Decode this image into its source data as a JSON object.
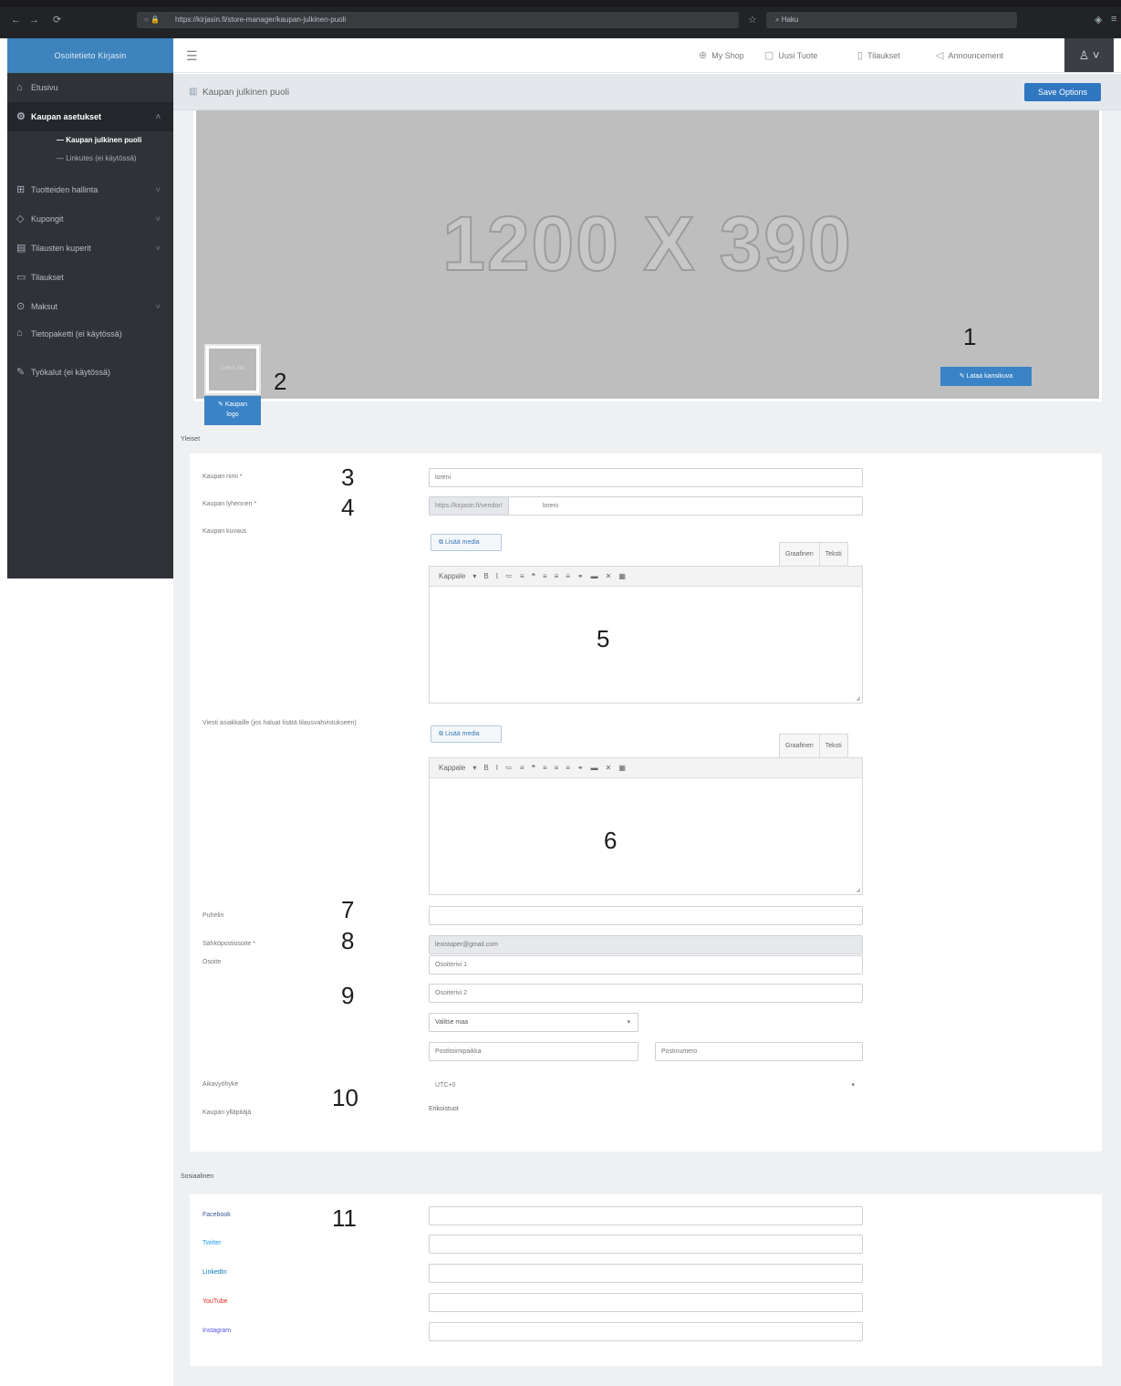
{
  "browser": {
    "url": "https://kirjasin.fi/store-manager/kaupan-julkinen-puoli",
    "search": "Haku",
    "back": "←",
    "forward": "→",
    "reload": "⟳"
  },
  "app": {
    "brand": "Osoitetieto Kirjasin"
  },
  "sidebar": {
    "items": [
      {
        "label": "Etusivu",
        "icon": "home-icon"
      },
      {
        "label": "Kaupan asetukset",
        "icon": "gear-icon",
        "active": true,
        "sub": [
          {
            "label": "— Kaupan julkinen puoli",
            "current": true
          },
          {
            "label": "— Linkutes (ei käytössä)"
          }
        ]
      },
      {
        "label": "Tuotteiden hallinta",
        "icon": "box-icon"
      },
      {
        "label": "Kupongit",
        "icon": "tag-icon"
      },
      {
        "label": "Tilausten kuperit",
        "icon": "building-icon"
      },
      {
        "label": "Tilaukset",
        "icon": "clipboard-icon"
      },
      {
        "label": "Maksut",
        "icon": "dollar-icon"
      },
      {
        "label": "Tietopaketti (ei käytössä)",
        "icon": "graduation-icon"
      },
      {
        "label": "Työkalut (ei käytössä)",
        "icon": "wrench-icon"
      }
    ]
  },
  "topbar": {
    "items": [
      {
        "label": "My Shop",
        "icon": "globe-icon"
      },
      {
        "label": "Uusi Tuote",
        "icon": "cube-icon"
      },
      {
        "label": "Tilaukset",
        "icon": "clipboard-icon"
      },
      {
        "label": "Announcement",
        "icon": "megaphone-icon"
      }
    ],
    "user_icon": "user-icon"
  },
  "page": {
    "title": "Kaupan julkinen puoli",
    "save_label": "Save Options"
  },
  "banner": {
    "placeholder": "1200 X 390",
    "change_cover": "✎ Lataa kansikuva",
    "logo_btn_line1": "✎ Kaupan",
    "logo_btn_line2": "logo",
    "logo_thumb": "1200 X 390"
  },
  "sections": {
    "general": "Yleiset",
    "social": "Sosiaalinen"
  },
  "form": {
    "store_name_label": "Kaupan nimi *",
    "store_name_value": "loreni",
    "store_url_label": "Kaupan lyhennen *",
    "store_url_prefix": "https://kirjasin.fi/vendor/",
    "store_url_value": "loreni",
    "description_label": "Kaupan kuvaus",
    "message_label": "Viesti asiakkaille (jos haluat lisätä tilausvahvistukseen)",
    "add_media": "Lisää media",
    "tab_visual": "Graafinen",
    "tab_text": "Teksti",
    "format": "Kappale",
    "phone_label": "Puhelin",
    "phone_value": "",
    "email_label": "Sähköpostiosoite *",
    "email_value": "lexistaper@gmail.com",
    "address_label": "Osoite",
    "address1": "Osoiterivi 1",
    "address2": "Osoiterivi 2",
    "country": "Valitse maa",
    "city": "Postitoimipaikka",
    "postcode": "Postinumero",
    "timezone_label": "Aikavyöhyke",
    "timezone_value": "UTC+0",
    "owner_label": "Kaupan ylläpitäjä",
    "owner_value": "Erikoistuot"
  },
  "social": {
    "facebook": "Facebook",
    "twitter": "Twitter",
    "linkedin": "LinkedIn",
    "youtube": "YouTube",
    "instagram": "Instagram"
  },
  "colors": {
    "sidebar": "#2f3337",
    "brand": "#3d83bd",
    "primary": "#2f77c1",
    "facebook": "#3b5998",
    "twitter": "#1da1f2",
    "linkedin": "#0077b5",
    "youtube": "#e02a20",
    "instagram": "#5851db"
  },
  "callouts": [
    "1",
    "2",
    "3",
    "4",
    "5",
    "6",
    "7",
    "8",
    "9",
    "10",
    "11"
  ]
}
